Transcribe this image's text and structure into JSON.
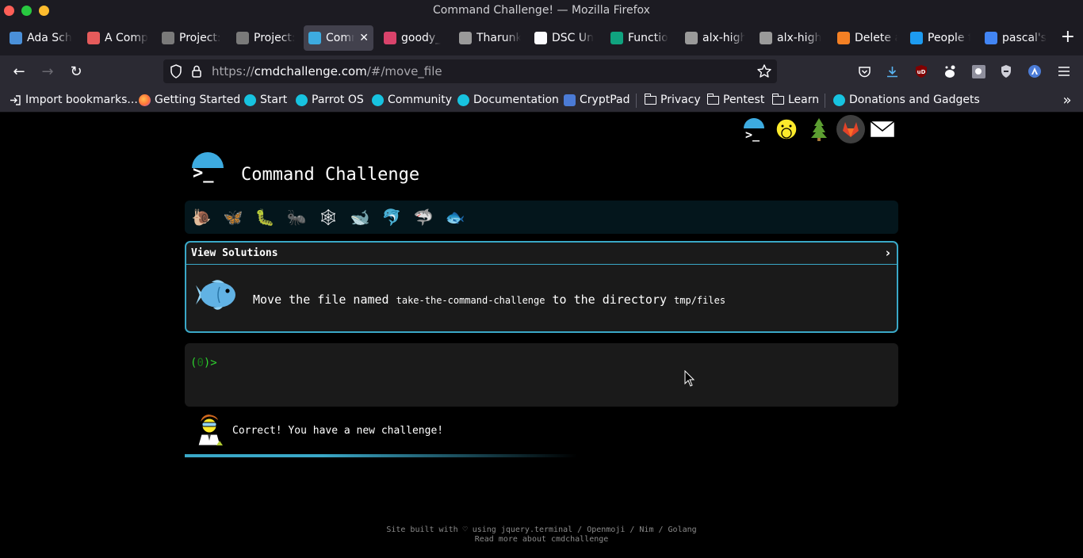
{
  "window": {
    "title": "Command Challenge! — Mozilla Firefox"
  },
  "tabs": [
    {
      "label": "Ada Sch",
      "favicon": "ada-icon",
      "color": "#4a90d9"
    },
    {
      "label": "A Comp",
      "favicon": "asterisk-icon",
      "color": "#e55b5b"
    },
    {
      "label": "Project:",
      "favicon": "alx-icon",
      "color": "#7a7a7a"
    },
    {
      "label": "Project:",
      "favicon": "alx-icon",
      "color": "#7a7a7a"
    },
    {
      "label": "Comm",
      "favicon": "terminal-icon",
      "color": "#3dabe0",
      "active": true
    },
    {
      "label": "goody_",
      "favicon": "avatar-icon",
      "color": "#d9436b"
    },
    {
      "label": "Tharunk",
      "favicon": "github-icon",
      "color": "#9a9a9a"
    },
    {
      "label": "DSC Un",
      "favicon": "check-circle-icon",
      "color": "#fbfbfe"
    },
    {
      "label": "Functio",
      "favicon": "openai-icon",
      "color": "#10a37f"
    },
    {
      "label": "alx-high",
      "favicon": "github-icon",
      "color": "#9a9a9a"
    },
    {
      "label": "alx-high",
      "favicon": "github-icon",
      "color": "#9a9a9a"
    },
    {
      "label": "Delete a",
      "favicon": "stackoverflow-icon",
      "color": "#f48024"
    },
    {
      "label": "People f",
      "favicon": "twitter-icon",
      "color": "#1d9bf0"
    },
    {
      "label": "pascal's",
      "favicon": "google-icon",
      "color": "#4285f4"
    }
  ],
  "navigation": {
    "url_prefix": "https://",
    "url_host": "cmdchallenge.com",
    "url_path": "/#/move_file"
  },
  "bookmarks": [
    {
      "label": "Import bookmarks...",
      "icon": "import-icon"
    },
    {
      "label": "Getting Started",
      "icon": "firefox-icon"
    },
    {
      "label": "Start",
      "icon": "parrot-icon"
    },
    {
      "label": "Parrot OS",
      "icon": "parrot-icon"
    },
    {
      "label": "Community",
      "icon": "parrot-icon"
    },
    {
      "label": "Documentation",
      "icon": "parrot-icon"
    },
    {
      "label": "CryptPad",
      "icon": "shield-icon"
    },
    {
      "label": "Privacy",
      "icon": "folder-icon"
    },
    {
      "label": "Pentest",
      "icon": "folder-icon"
    },
    {
      "label": "Learn",
      "icon": "folder-icon"
    },
    {
      "label": "Donations and Gadgets",
      "icon": "parrot-icon"
    }
  ],
  "page": {
    "site_title": "Command Challenge",
    "view_solutions": "View Solutions",
    "view_solutions_chevron": "›",
    "challenge": {
      "prefix": "Move the file named ",
      "file": "take-the-command-challenge",
      "middle": " to the directory ",
      "directory": "tmp/files"
    },
    "prompt_open": "(",
    "prompt_count": "0",
    "prompt_close": ")>",
    "status_message": "Correct! You have a new challenge!",
    "progress": 0.55,
    "footer_line1": "Site built with ♡ using jquery.terminal / Openmoji / Nim / Golang",
    "footer_line2": "Read more about cmdchallenge"
  },
  "levels": [
    {
      "name": "snail-icon",
      "glyph": "🐌"
    },
    {
      "name": "butterfly-icon",
      "glyph": "🦋"
    },
    {
      "name": "caterpillar-icon",
      "glyph": "🐛"
    },
    {
      "name": "ant-icon",
      "glyph": "🐜"
    },
    {
      "name": "spider-web-icon",
      "glyph": "🕸"
    },
    {
      "name": "whale-icon",
      "glyph": "🐋"
    },
    {
      "name": "dolphin-icon",
      "glyph": "🐬"
    },
    {
      "name": "shark-icon",
      "glyph": "🦈"
    },
    {
      "name": "fish-icon",
      "glyph": "🐟"
    }
  ],
  "colors": {
    "accent": "#3aa8c7",
    "prompt_green": "#2fd42f",
    "chrome_dark": "#1c1b22",
    "chrome_toolbar": "#2b2a33"
  }
}
